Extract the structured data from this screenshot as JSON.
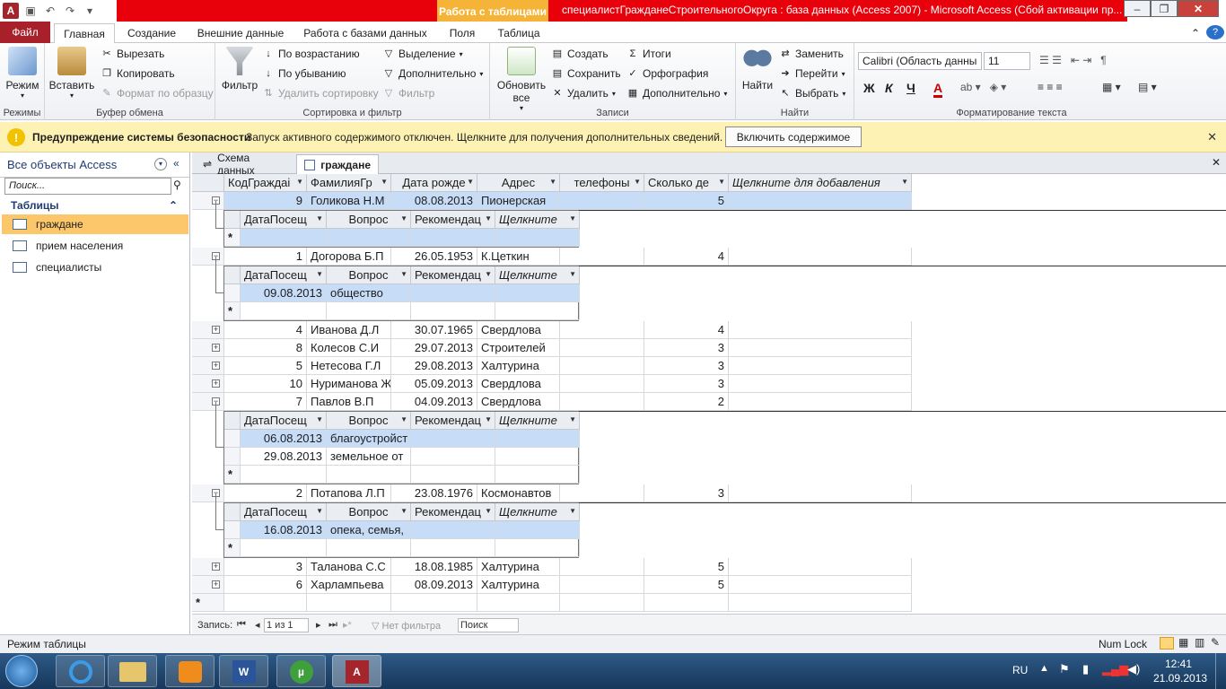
{
  "window": {
    "title": "специалистГражданеСтроительногоОкруга : база данных (Access 2007)  -  Microsoft Access (Сбой активации пр...",
    "context_tab": "Работа с таблицами",
    "app_icon_letter": "A"
  },
  "ribbon_tabs": [
    "Файл",
    "Главная",
    "Создание",
    "Внешние данные",
    "Работа с базами данных",
    "Поля",
    "Таблица"
  ],
  "groups": {
    "modes": {
      "label": "Режимы",
      "view": "Режим"
    },
    "clipboard": {
      "label": "Буфер обмена",
      "paste": "Вставить",
      "cut": "Вырезать",
      "copy": "Копировать",
      "format_painter": "Формат по образцу"
    },
    "sort": {
      "label": "Сортировка и фильтр",
      "filter": "Фильтр",
      "asc": "По возрастанию",
      "desc": "По убыванию",
      "remove_sort": "Удалить сортировку",
      "selection": "Выделение",
      "advanced": "Дополнительно",
      "toggle_filter": "Фильтр"
    },
    "records": {
      "label": "Записи",
      "refresh": "Обновить все",
      "new": "Создать",
      "save": "Сохранить",
      "delete": "Удалить",
      "totals": "Итоги",
      "spelling": "Орфография",
      "more": "Дополнительно"
    },
    "find": {
      "label": "Найти",
      "find": "Найти",
      "replace": "Заменить",
      "goto": "Перейти",
      "select": "Выбрать"
    },
    "text": {
      "label": "Форматирование текста",
      "font": "Calibri (Область данны",
      "size": "11",
      "bold": "Ж",
      "italic": "К",
      "underline": "Ч",
      "color_a": "A"
    }
  },
  "security": {
    "title": "Предупреждение системы безопасности",
    "text": "Запуск активного содержимого отключен. Щелкните для получения дополнительных сведений.",
    "button": "Включить содержимое"
  },
  "nav": {
    "header": "Все объекты Access",
    "search_placeholder": "Поиск...",
    "section": "Таблицы",
    "items": [
      "граждане",
      "прием населения",
      "специалисты"
    ]
  },
  "doc_tabs": [
    "Схема данных",
    "граждане"
  ],
  "grid": {
    "headers": [
      "КодГраждаі",
      "ФамилияГр",
      "Дата рожде",
      "Адрес",
      "телефоны",
      "Сколько де",
      "Щелкните для добавления"
    ],
    "sub_headers": [
      "ДатаПосещ",
      "Вопрос",
      "Рекомендац",
      "Щелкните"
    ],
    "rows": [
      {
        "id": "9",
        "name": "Голикова Н.М",
        "dob": "08.08.2013",
        "addr": "Пионерская",
        "phone": "",
        "kids": "5",
        "expanded": true,
        "sub": []
      },
      {
        "id": "1",
        "name": "Догорова Б.П",
        "dob": "26.05.1953",
        "addr": "К.Цеткин",
        "phone": "",
        "kids": "4",
        "expanded": true,
        "sub": [
          {
            "date": "09.08.2013",
            "q": "общество"
          }
        ]
      },
      {
        "id": "4",
        "name": "Иванова Д.Л",
        "dob": "30.07.1965",
        "addr": "Свердлова",
        "phone": "",
        "kids": "4"
      },
      {
        "id": "8",
        "name": "Колесов С.И",
        "dob": "29.07.2013",
        "addr": "Строителей",
        "phone": "",
        "kids": "3"
      },
      {
        "id": "5",
        "name": "Нетесова Г.Л",
        "dob": "29.08.2013",
        "addr": "Халтурина",
        "phone": "",
        "kids": "3"
      },
      {
        "id": "10",
        "name": "Нуриманова Ж",
        "dob": "05.09.2013",
        "addr": "Свердлова",
        "phone": "",
        "kids": "3"
      },
      {
        "id": "7",
        "name": "Павлов В.П",
        "dob": "04.09.2013",
        "addr": "Свердлова",
        "phone": "",
        "kids": "2",
        "expanded": true,
        "sub": [
          {
            "date": "06.08.2013",
            "q": "благоустройст"
          },
          {
            "date": "29.08.2013",
            "q": "земельное от"
          }
        ]
      },
      {
        "id": "2",
        "name": "Потапова Л.П",
        "dob": "23.08.1976",
        "addr": "Космонавтов",
        "phone": "",
        "kids": "3",
        "expanded": true,
        "sub": [
          {
            "date": "16.08.2013",
            "q": "опека, семья,"
          }
        ]
      },
      {
        "id": "3",
        "name": "Таланова С.С",
        "dob": "18.08.1985",
        "addr": "Халтурина",
        "phone": "",
        "kids": "5"
      },
      {
        "id": "6",
        "name": "Харлампьева",
        "dob": "08.09.2013",
        "addr": "Халтурина",
        "phone": "",
        "kids": "5"
      }
    ]
  },
  "record_nav": {
    "label": "Запись:",
    "position": "1 из 1",
    "filter": "Нет фильтра",
    "search": "Поиск"
  },
  "status": {
    "mode": "Режим таблицы",
    "numlock": "Num Lock"
  },
  "taskbar": {
    "lang": "RU",
    "time": "12:41",
    "date": "21.09.2013"
  }
}
